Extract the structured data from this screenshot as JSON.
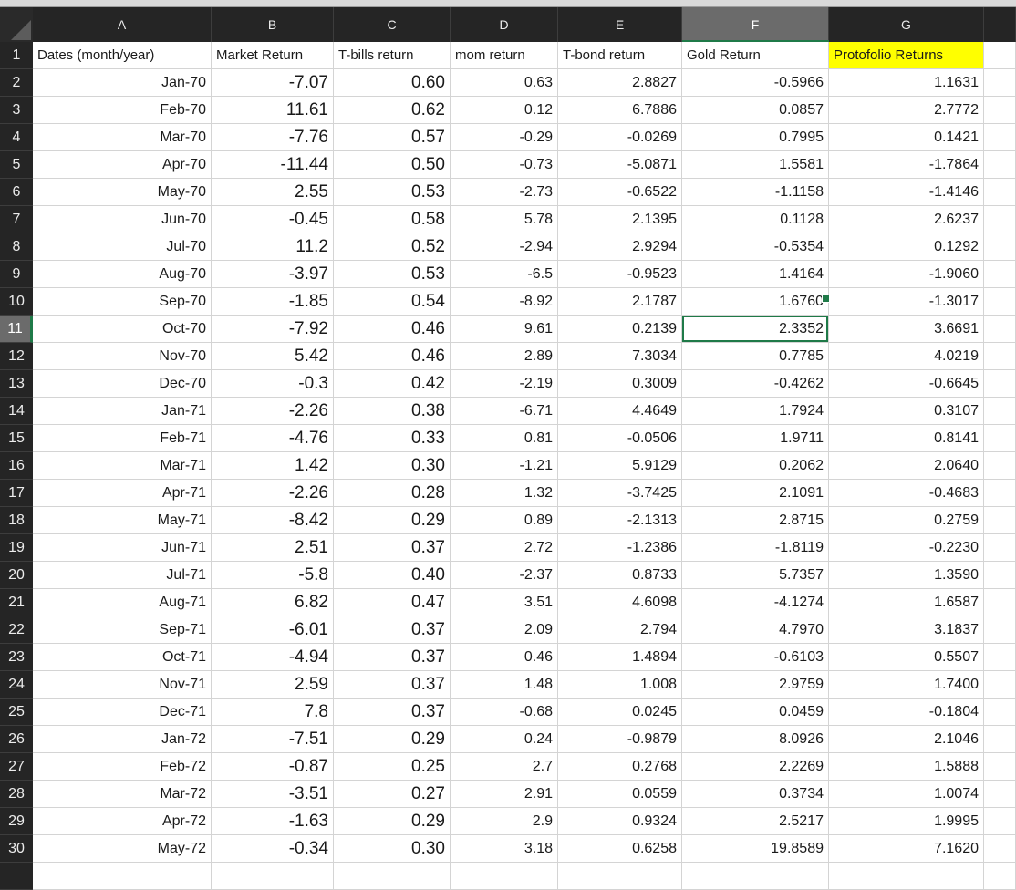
{
  "columns": [
    "A",
    "B",
    "C",
    "D",
    "E",
    "F",
    "G"
  ],
  "row_numbers": [
    "1",
    "2",
    "3",
    "4",
    "5",
    "6",
    "7",
    "8",
    "9",
    "10",
    "11",
    "12",
    "13",
    "14",
    "15",
    "16",
    "17",
    "18",
    "19",
    "20",
    "21",
    "22",
    "23",
    "24",
    "25",
    "26",
    "27",
    "28",
    "29",
    "30"
  ],
  "selected_cell": "F11",
  "accent_color": "#1f7a48",
  "highlight_color": "#ffff00",
  "headers": [
    "Dates (month/year)",
    "Market Return",
    "T-bills return",
    "mom return",
    "T-bond return",
    "Gold Return",
    "Protofolio Returns"
  ],
  "rows": [
    [
      "Jan-70",
      "-7.07",
      "0.60",
      "0.63",
      "2.8827",
      "-0.5966",
      "1.1631"
    ],
    [
      "Feb-70",
      "11.61",
      "0.62",
      "0.12",
      "6.7886",
      "0.0857",
      "2.7772"
    ],
    [
      "Mar-70",
      "-7.76",
      "0.57",
      "-0.29",
      "-0.0269",
      "0.7995",
      "0.1421"
    ],
    [
      "Apr-70",
      "-11.44",
      "0.50",
      "-0.73",
      "-5.0871",
      "1.5581",
      "-1.7864"
    ],
    [
      "May-70",
      "2.55",
      "0.53",
      "-2.73",
      "-0.6522",
      "-1.1158",
      "-1.4146"
    ],
    [
      "Jun-70",
      "-0.45",
      "0.58",
      "5.78",
      "2.1395",
      "0.1128",
      "2.6237"
    ],
    [
      "Jul-70",
      "11.2",
      "0.52",
      "-2.94",
      "2.9294",
      "-0.5354",
      "0.1292"
    ],
    [
      "Aug-70",
      "-3.97",
      "0.53",
      "-6.5",
      "-0.9523",
      "1.4164",
      "-1.9060"
    ],
    [
      "Sep-70",
      "-1.85",
      "0.54",
      "-8.92",
      "2.1787",
      "1.6760",
      "-1.3017"
    ],
    [
      "Oct-70",
      "-7.92",
      "0.46",
      "9.61",
      "0.2139",
      "2.3352",
      "3.6691"
    ],
    [
      "Nov-70",
      "5.42",
      "0.46",
      "2.89",
      "7.3034",
      "0.7785",
      "4.0219"
    ],
    [
      "Dec-70",
      "-0.3",
      "0.42",
      "-2.19",
      "0.3009",
      "-0.4262",
      "-0.6645"
    ],
    [
      "Jan-71",
      "-2.26",
      "0.38",
      "-6.71",
      "4.4649",
      "1.7924",
      "0.3107"
    ],
    [
      "Feb-71",
      "-4.76",
      "0.33",
      "0.81",
      "-0.0506",
      "1.9711",
      "0.8141"
    ],
    [
      "Mar-71",
      "1.42",
      "0.30",
      "-1.21",
      "5.9129",
      "0.2062",
      "2.0640"
    ],
    [
      "Apr-71",
      "-2.26",
      "0.28",
      "1.32",
      "-3.7425",
      "2.1091",
      "-0.4683"
    ],
    [
      "May-71",
      "-8.42",
      "0.29",
      "0.89",
      "-2.1313",
      "2.8715",
      "0.2759"
    ],
    [
      "Jun-71",
      "2.51",
      "0.37",
      "2.72",
      "-1.2386",
      "-1.8119",
      "-0.2230"
    ],
    [
      "Jul-71",
      "-5.8",
      "0.40",
      "-2.37",
      "0.8733",
      "5.7357",
      "1.3590"
    ],
    [
      "Aug-71",
      "6.82",
      "0.47",
      "3.51",
      "4.6098",
      "-4.1274",
      "1.6587"
    ],
    [
      "Sep-71",
      "-6.01",
      "0.37",
      "2.09",
      "2.794",
      "4.7970",
      "3.1837"
    ],
    [
      "Oct-71",
      "-4.94",
      "0.37",
      "0.46",
      "1.4894",
      "-0.6103",
      "0.5507"
    ],
    [
      "Nov-71",
      "2.59",
      "0.37",
      "1.48",
      "1.008",
      "2.9759",
      "1.7400"
    ],
    [
      "Dec-71",
      "7.8",
      "0.37",
      "-0.68",
      "0.0245",
      "0.0459",
      "-0.1804"
    ],
    [
      "Jan-72",
      "-7.51",
      "0.29",
      "0.24",
      "-0.9879",
      "8.0926",
      "2.1046"
    ],
    [
      "Feb-72",
      "-0.87",
      "0.25",
      "2.7",
      "0.2768",
      "2.2269",
      "1.5888"
    ],
    [
      "Mar-72",
      "-3.51",
      "0.27",
      "2.91",
      "0.0559",
      "0.3734",
      "1.0074"
    ],
    [
      "Apr-72",
      "-1.63",
      "0.29",
      "2.9",
      "0.9324",
      "2.5217",
      "1.9995"
    ],
    [
      "May-72",
      "-0.34",
      "0.30",
      "3.18",
      "0.6258",
      "19.8589",
      "7.1620"
    ]
  ]
}
